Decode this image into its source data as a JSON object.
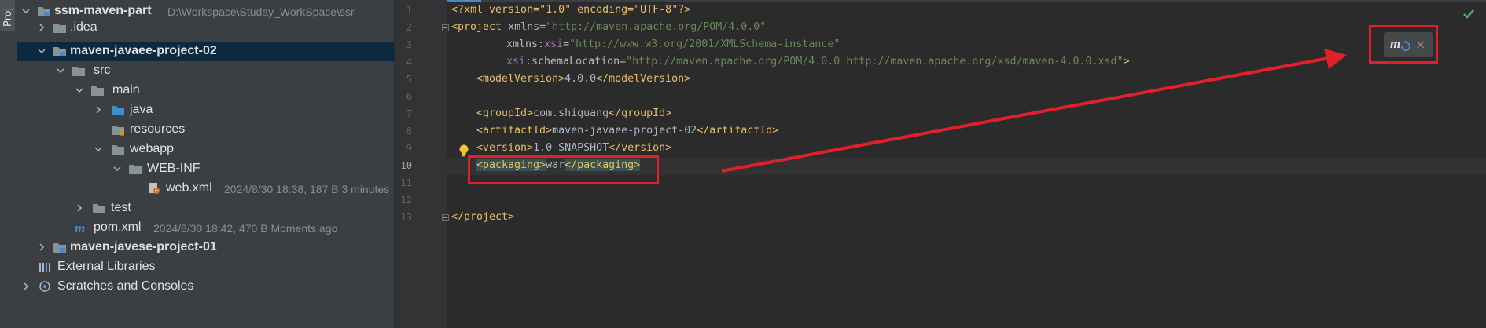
{
  "stripe": {
    "tab_label": "Proj"
  },
  "tree": {
    "items": [
      {
        "label": "ssm-maven-part",
        "meta": "D:\\Workspace\\Studay_WorkSpace\\ssr",
        "icon": "module-folder-icon",
        "expanded": true
      },
      {
        "label": ".idea",
        "meta": "",
        "icon": "folder-icon",
        "expanded": false
      },
      {
        "label": "maven-javaee-project-02",
        "meta": "",
        "icon": "module-folder-icon",
        "expanded": true
      },
      {
        "label": "src",
        "meta": "",
        "icon": "folder-icon",
        "expanded": true
      },
      {
        "label": "main",
        "meta": "",
        "icon": "folder-icon",
        "expanded": true
      },
      {
        "label": "java",
        "meta": "",
        "icon": "source-folder-icon",
        "expanded": false
      },
      {
        "label": "resources",
        "meta": "",
        "icon": "resources-folder-icon",
        "expanded": null
      },
      {
        "label": "webapp",
        "meta": "",
        "icon": "folder-icon",
        "expanded": true
      },
      {
        "label": "WEB-INF",
        "meta": "",
        "icon": "folder-icon",
        "expanded": true
      },
      {
        "label": "web.xml",
        "meta": "2024/8/30 18:38, 187 B 3 minutes",
        "icon": "web-xml-icon",
        "expanded": null
      },
      {
        "label": "test",
        "meta": "",
        "icon": "folder-icon",
        "expanded": false
      },
      {
        "label": "pom.xml",
        "meta": "2024/8/30 18:42, 470 B Moments ago",
        "icon": "maven-icon",
        "expanded": null
      },
      {
        "label": "maven-javese-project-01",
        "meta": "",
        "icon": "module-folder-icon",
        "expanded": false
      },
      {
        "label": "External Libraries",
        "meta": "",
        "icon": "libraries-icon",
        "expanded": false
      },
      {
        "label": "Scratches and Consoles",
        "meta": "",
        "icon": "scratches-icon",
        "expanded": false
      }
    ]
  },
  "editor": {
    "line_numbers": [
      "1",
      "2",
      "3",
      "4",
      "5",
      "6",
      "7",
      "8",
      "9",
      "10",
      "11",
      "12",
      "13"
    ],
    "current_line": "10",
    "lines": {
      "l1": {
        "open": "<?xml version=\"1.0\" encoding=\"UTF-8\"?>"
      },
      "l2": {
        "tag": "<project",
        "attr": "xmlns=",
        "val": "\"http://maven.apache.org/POM/4.0.0\""
      },
      "l3": {
        "attr1": "xmlns:",
        "ns": "xsi",
        "attr2": "=",
        "val": "\"http://www.w3.org/2001/XMLSchema-instance\""
      },
      "l4": {
        "ns": "xsi",
        "attr": ":schemaLocation=",
        "val": "\"http://maven.apache.org/POM/4.0.0 http://maven.apache.org/xsd/maven-4.0.0.xsd\"",
        "close": ">"
      },
      "l5": {
        "open": "<modelVersion>",
        "text": "4.0.0",
        "close": "</modelVersion>"
      },
      "l7": {
        "open": "<groupId>",
        "text": "com.shiguang",
        "close": "</groupId>"
      },
      "l8": {
        "open": "<artifactId>",
        "text": "maven-javaee-project-02",
        "close": "</artifactId>"
      },
      "l9": {
        "open": "<version>",
        "text": "1.0-SNAPSHOT",
        "close": "</version>"
      },
      "l10": {
        "open": "<packaging>",
        "text": "war",
        "close": "</packaging>"
      },
      "l13": {
        "close": "</project>"
      }
    }
  },
  "notification": {
    "action_icon": "maven-reload-icon",
    "close_label": "×"
  },
  "annotations": {
    "color": "#e0202a"
  }
}
